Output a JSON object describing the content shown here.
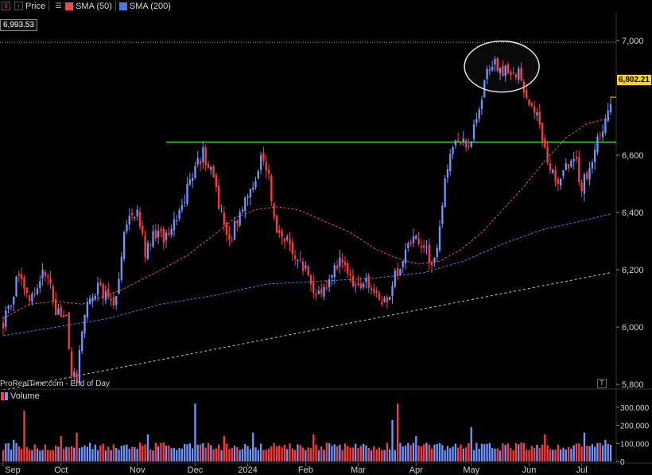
{
  "legend": {
    "price_label": "Price",
    "sma50_label": "SMA (50)",
    "sma200_label": "SMA (200)",
    "volume_label": "Volume",
    "sma50_color": "#e05050",
    "sma200_color": "#4a7ae0",
    "icons": [
      "collapse-icon",
      "chart-type-icon",
      "settings-icon"
    ]
  },
  "readouts": {
    "high_line_value": "6,993.53",
    "last_price": "6,802.21",
    "footer": "ProRealTime.com - End of Day",
    "index_box": "T"
  },
  "chart_data": {
    "type": "candlestick",
    "price_axis": {
      "ticks": [
        "7,000",
        "6,600",
        "6,400",
        "6,200",
        "6,000",
        "5,800"
      ],
      "ylim": [
        5770,
        7080
      ]
    },
    "volume_axis": {
      "ticks": [
        "300,000",
        "200,000",
        "100,000",
        "0"
      ],
      "ylim": [
        0,
        330000
      ]
    },
    "x_axis": {
      "labels": [
        "Sep",
        "Oct",
        "Nov",
        "Dec",
        "2024",
        "Feb",
        "Mar",
        "Apr",
        "May",
        "Jun",
        "Jul"
      ],
      "label_days": [
        0,
        22,
        51,
        73,
        93,
        115,
        135,
        157,
        178,
        200,
        220
      ]
    },
    "total_days": 231,
    "candle_colors": {
      "up": "#6f95ff",
      "down": "#ff3a3a"
    },
    "high_line": 6993.53,
    "last_price": 6802.21,
    "resistance_line": {
      "value": 6645,
      "from_day": 62,
      "to_day": 231,
      "color": "#3cc83c"
    },
    "trend_line": {
      "start": [
        0,
        5780
      ],
      "end": [
        231,
        6190
      ]
    },
    "highlight_ellipse": {
      "day": 189,
      "price": 6920
    },
    "price_waypoints": [
      [
        0,
        6020
      ],
      [
        6,
        6180
      ],
      [
        11,
        6100
      ],
      [
        16,
        6200
      ],
      [
        20,
        6060
      ],
      [
        24,
        6040
      ],
      [
        26,
        5850
      ],
      [
        28,
        5830
      ],
      [
        32,
        6100
      ],
      [
        37,
        6140
      ],
      [
        42,
        6060
      ],
      [
        46,
        6320
      ],
      [
        51,
        6430
      ],
      [
        54,
        6260
      ],
      [
        58,
        6330
      ],
      [
        63,
        6300
      ],
      [
        68,
        6430
      ],
      [
        72,
        6540
      ],
      [
        76,
        6610
      ],
      [
        80,
        6520
      ],
      [
        84,
        6340
      ],
      [
        86,
        6300
      ],
      [
        90,
        6410
      ],
      [
        94,
        6460
      ],
      [
        98,
        6600
      ],
      [
        101,
        6520
      ],
      [
        104,
        6330
      ],
      [
        108,
        6300
      ],
      [
        112,
        6240
      ],
      [
        115,
        6200
      ],
      [
        118,
        6140
      ],
      [
        121,
        6100
      ],
      [
        125,
        6180
      ],
      [
        128,
        6220
      ],
      [
        131,
        6180
      ],
      [
        134,
        6140
      ],
      [
        138,
        6180
      ],
      [
        142,
        6100
      ],
      [
        144,
        6060
      ],
      [
        147,
        6130
      ],
      [
        150,
        6200
      ],
      [
        154,
        6270
      ],
      [
        157,
        6320
      ],
      [
        160,
        6270
      ],
      [
        163,
        6230
      ],
      [
        166,
        6330
      ],
      [
        168,
        6540
      ],
      [
        171,
        6640
      ],
      [
        174,
        6660
      ],
      [
        177,
        6610
      ],
      [
        180,
        6720
      ],
      [
        183,
        6860
      ],
      [
        186,
        6930
      ],
      [
        189,
        6880
      ],
      [
        192,
        6900
      ],
      [
        196,
        6880
      ],
      [
        199,
        6820
      ],
      [
        202,
        6760
      ],
      [
        205,
        6660
      ],
      [
        208,
        6560
      ],
      [
        211,
        6510
      ],
      [
        214,
        6560
      ],
      [
        217,
        6600
      ],
      [
        220,
        6490
      ],
      [
        223,
        6560
      ],
      [
        226,
        6650
      ],
      [
        229,
        6720
      ],
      [
        231,
        6802
      ]
    ],
    "sma50_waypoints": [
      [
        0,
        6030
      ],
      [
        10,
        6080
      ],
      [
        20,
        6090
      ],
      [
        30,
        6080
      ],
      [
        45,
        6130
      ],
      [
        60,
        6200
      ],
      [
        70,
        6250
      ],
      [
        80,
        6320
      ],
      [
        88,
        6380
      ],
      [
        96,
        6410
      ],
      [
        104,
        6420
      ],
      [
        112,
        6410
      ],
      [
        122,
        6370
      ],
      [
        132,
        6330
      ],
      [
        142,
        6270
      ],
      [
        150,
        6240
      ],
      [
        158,
        6220
      ],
      [
        166,
        6230
      ],
      [
        174,
        6270
      ],
      [
        182,
        6330
      ],
      [
        190,
        6410
      ],
      [
        198,
        6490
      ],
      [
        206,
        6580
      ],
      [
        214,
        6660
      ],
      [
        222,
        6710
      ],
      [
        231,
        6730
      ]
    ],
    "sma200_waypoints": [
      [
        0,
        5970
      ],
      [
        20,
        6000
      ],
      [
        40,
        6030
      ],
      [
        60,
        6080
      ],
      [
        80,
        6110
      ],
      [
        100,
        6150
      ],
      [
        120,
        6160
      ],
      [
        140,
        6170
      ],
      [
        160,
        6190
      ],
      [
        175,
        6230
      ],
      [
        190,
        6290
      ],
      [
        205,
        6340
      ],
      [
        220,
        6370
      ],
      [
        231,
        6395
      ]
    ],
    "volume_base": 60000,
    "volume_spikes": [
      [
        4,
        120000
      ],
      [
        8,
        280000
      ],
      [
        22,
        140000
      ],
      [
        28,
        160000
      ],
      [
        55,
        150000
      ],
      [
        73,
        320000
      ],
      [
        84,
        140000
      ],
      [
        95,
        160000
      ],
      [
        118,
        150000
      ],
      [
        148,
        230000
      ],
      [
        150,
        320000
      ],
      [
        157,
        140000
      ],
      [
        178,
        190000
      ],
      [
        206,
        150000
      ],
      [
        221,
        160000
      ],
      [
        229,
        120000
      ]
    ]
  }
}
